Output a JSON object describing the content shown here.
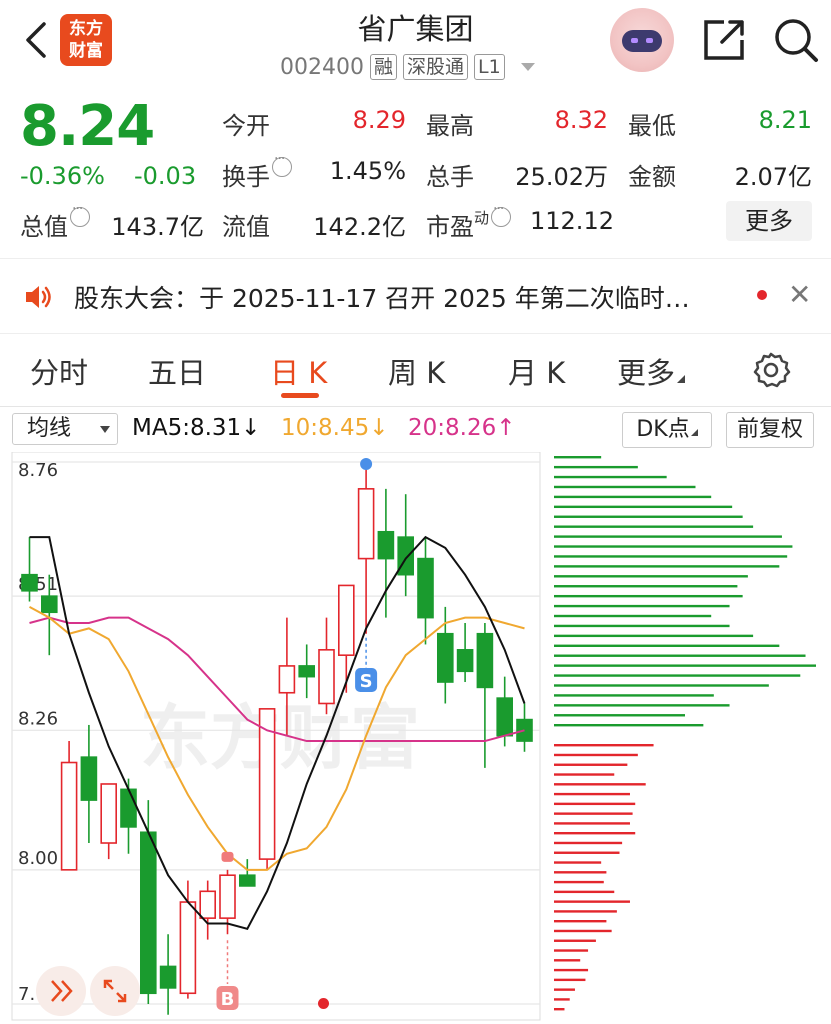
{
  "header": {
    "title": "省广集团",
    "logo_text_1": "东方",
    "logo_text_2": "财富",
    "code": "002400",
    "tags": [
      "融",
      "深股通",
      "L1"
    ]
  },
  "quote": {
    "price": "8.24",
    "change_pct": "-0.36%",
    "change": "-0.03",
    "open_label": "今开",
    "open": "8.29",
    "high_label": "最高",
    "high": "8.32",
    "low_label": "最低",
    "low": "8.21",
    "turnover_label": "换手",
    "turnover": "1.45%",
    "volume_label": "总手",
    "volume": "25.02万",
    "amount_label": "金额",
    "amount": "2.07亿",
    "mcap_label": "总值",
    "mcap": "143.7亿",
    "float_label": "流值",
    "float": "142.2亿",
    "pe_label": "市盈",
    "pe_sup": "动",
    "pe": "112.12",
    "more": "更多"
  },
  "notice": {
    "text": "股东大会：于 2025-11-17 召开 2025 年第二次临时…"
  },
  "tabs": [
    "分时",
    "五日",
    "日 K",
    "周 K",
    "月 K",
    "更多"
  ],
  "active_tab": "日 K",
  "ma_bar": {
    "select": "均线",
    "ma5": "MA5:8.31↓",
    "ma10": "10:8.45↓",
    "ma20": "20:8.26↑",
    "dk": "DK点",
    "adjust": "前复权"
  },
  "colors": {
    "up": "#e3262c",
    "down": "#1a9b2e",
    "ma5": "#111111",
    "ma10": "#f0a830",
    "ma20": "#d6338a",
    "brand": "#e84a1e"
  },
  "chart_data": {
    "type": "candlestick",
    "y_ticks": [
      "8.76",
      "8.51",
      "8.26",
      "8.00",
      "7.75"
    ],
    "ylim": [
      7.75,
      8.76
    ],
    "candles": [
      {
        "o": 8.55,
        "h": 8.62,
        "l": 8.5,
        "c": 8.52
      },
      {
        "o": 8.51,
        "h": 8.55,
        "l": 8.4,
        "c": 8.48
      },
      {
        "o": 8.0,
        "h": 8.24,
        "l": 8.0,
        "c": 8.2
      },
      {
        "o": 8.21,
        "h": 8.27,
        "l": 8.05,
        "c": 8.13
      },
      {
        "o": 8.05,
        "h": 8.16,
        "l": 8.02,
        "c": 8.16
      },
      {
        "o": 8.15,
        "h": 8.17,
        "l": 8.03,
        "c": 8.08
      },
      {
        "o": 8.07,
        "h": 8.13,
        "l": 7.75,
        "c": 7.77
      },
      {
        "o": 7.82,
        "h": 7.88,
        "l": 7.73,
        "c": 7.78
      },
      {
        "o": 7.77,
        "h": 7.98,
        "l": 7.76,
        "c": 7.94
      },
      {
        "o": 7.91,
        "h": 7.98,
        "l": 7.87,
        "c": 7.96
      },
      {
        "o": 7.91,
        "h": 8.0,
        "l": 7.88,
        "c": 7.99
      },
      {
        "o": 7.99,
        "h": 8.02,
        "l": 7.97,
        "c": 7.97
      },
      {
        "o": 8.02,
        "h": 8.3,
        "l": 8.0,
        "c": 8.3
      },
      {
        "o": 8.33,
        "h": 8.47,
        "l": 8.25,
        "c": 8.38
      },
      {
        "o": 8.38,
        "h": 8.42,
        "l": 8.32,
        "c": 8.36
      },
      {
        "o": 8.31,
        "h": 8.47,
        "l": 8.29,
        "c": 8.41
      },
      {
        "o": 8.4,
        "h": 8.51,
        "l": 8.33,
        "c": 8.53
      },
      {
        "o": 8.58,
        "h": 8.76,
        "l": 8.44,
        "c": 8.71
      },
      {
        "o": 8.63,
        "h": 8.71,
        "l": 8.47,
        "c": 8.58
      },
      {
        "o": 8.62,
        "h": 8.7,
        "l": 8.51,
        "c": 8.55
      },
      {
        "o": 8.58,
        "h": 8.62,
        "l": 8.42,
        "c": 8.47
      },
      {
        "o": 8.44,
        "h": 8.49,
        "l": 8.31,
        "c": 8.35
      },
      {
        "o": 8.41,
        "h": 8.46,
        "l": 8.35,
        "c": 8.37
      },
      {
        "o": 8.44,
        "h": 8.46,
        "l": 8.19,
        "c": 8.34
      },
      {
        "o": 8.32,
        "h": 8.36,
        "l": 8.23,
        "c": 8.25
      },
      {
        "o": 8.28,
        "h": 8.31,
        "l": 8.22,
        "c": 8.24
      }
    ],
    "ma5": [
      8.62,
      8.62,
      8.44,
      8.33,
      8.23,
      8.15,
      8.07,
      7.99,
      7.94,
      7.9,
      7.9,
      7.89,
      7.96,
      8.05,
      8.16,
      8.25,
      8.35,
      8.45,
      8.52,
      8.58,
      8.62,
      8.6,
      8.55,
      8.49,
      8.41,
      8.31
    ],
    "ma10": [
      8.49,
      8.47,
      8.44,
      8.45,
      8.43,
      8.37,
      8.29,
      8.21,
      8.14,
      8.08,
      8.03,
      8.0,
      8.0,
      8.03,
      8.04,
      8.08,
      8.15,
      8.25,
      8.34,
      8.4,
      8.43,
      8.46,
      8.47,
      8.47,
      8.46,
      8.45
    ],
    "ma20": [
      8.46,
      8.47,
      8.46,
      8.46,
      8.47,
      8.47,
      8.45,
      8.43,
      8.4,
      8.36,
      8.32,
      8.28,
      8.26,
      8.25,
      8.24,
      8.24,
      8.24,
      8.24,
      8.24,
      8.24,
      8.24,
      8.24,
      8.24,
      8.24,
      8.25,
      8.26
    ],
    "markers": [
      {
        "index": 10,
        "label": "B"
      },
      {
        "index": 17,
        "label": "S"
      }
    ],
    "volume_profile_up": [
      0.18,
      0.32,
      0.43,
      0.54,
      0.6,
      0.68,
      0.72,
      0.76,
      0.87,
      0.91,
      0.89,
      0.86,
      0.74,
      0.7,
      0.72,
      0.67,
      0.6,
      0.67,
      0.76,
      0.86,
      0.96,
      1.0,
      0.94,
      0.82,
      0.61,
      0.67,
      0.5,
      0.57
    ],
    "volume_profile_down": [
      0.38,
      0.32,
      0.28,
      0.23,
      0.35,
      0.29,
      0.31,
      0.3,
      0.29,
      0.31,
      0.26,
      0.25,
      0.18,
      0.2,
      0.19,
      0.23,
      0.29,
      0.24,
      0.2,
      0.22,
      0.16,
      0.13,
      0.1,
      0.13,
      0.12,
      0.08,
      0.06,
      0.04
    ]
  }
}
